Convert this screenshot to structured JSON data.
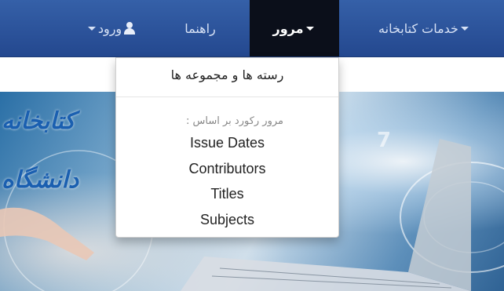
{
  "navbar": {
    "login": {
      "label": "ورود",
      "icon": "user-icon"
    },
    "guide": {
      "label": "راهنما"
    },
    "browse": {
      "label": "مرور"
    },
    "services": {
      "label": "خدمات کتابخانه"
    }
  },
  "browse_menu": {
    "communities": "رسته ها و مجموعه ها",
    "header": "مرور رکورد بر اساس :",
    "items": [
      "Issue Dates",
      "Contributors",
      "Titles",
      "Subjects"
    ]
  },
  "hero": {
    "calligraphy_line1": "کتابخانه",
    "calligraphy_line2": "دانشگاه"
  },
  "colors": {
    "navbar": "#2c5298",
    "active_tab": "#0b0f1a",
    "calligraphy": "#1a5fb0"
  }
}
